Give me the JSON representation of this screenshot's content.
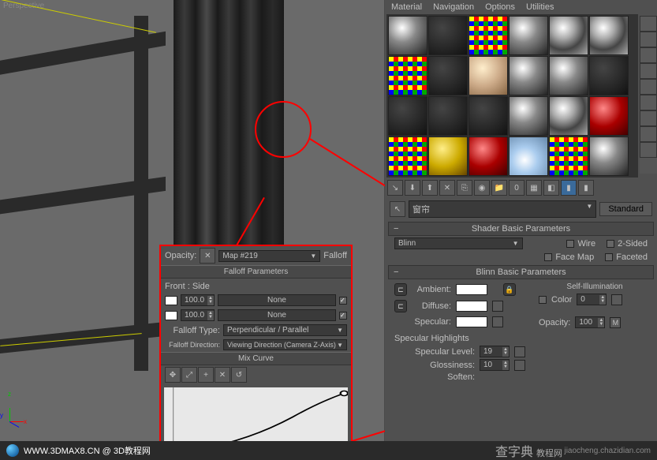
{
  "viewport": {
    "label": "Perspective"
  },
  "menu": {
    "material": "Material",
    "navigation": "Navigation",
    "options": "Options",
    "utilities": "Utilities"
  },
  "name_row": {
    "material_name": "窗帘",
    "type_button": "Standard"
  },
  "shader_rollout": {
    "title": "Shader Basic Parameters",
    "shader": "Blinn",
    "wire": "Wire",
    "two_sided": "2-Sided",
    "face_map": "Face Map",
    "faceted": "Faceted"
  },
  "blinn_rollout": {
    "title": "Blinn Basic Parameters",
    "self_illum_label": "Self-Illumination",
    "ambient": "Ambient:",
    "diffuse": "Diffuse:",
    "specular": "Specular:",
    "color_label": "Color",
    "color_value": "0",
    "opacity_label": "Opacity:",
    "opacity_value": "100",
    "opacity_map": "M",
    "spec_highlights": "Specular Highlights",
    "spec_level": "Specular Level:",
    "spec_level_val": "19",
    "glossiness": "Glossiness:",
    "glossiness_val": "10",
    "soften": "Soften:"
  },
  "map_panel": {
    "opacity_label": "Opacity:",
    "map_name": "Map #219",
    "map_type": "Falloff",
    "falloff_params": "Falloff Parameters",
    "front_side": "Front : Side",
    "val1": "100.0",
    "map1": "None",
    "val2": "100.0",
    "map2": "None",
    "falloff_type_label": "Falloff Type:",
    "falloff_type": "Perpendicular / Parallel",
    "falloff_dir_label": "Falloff Direction:",
    "falloff_dir": "Viewing Direction (Camera Z-Axis)",
    "mix_curve": "Mix Curve"
  },
  "footer": {
    "url": "WWW.3DMAX8.CN @ 3D教程网",
    "brand": "查字典",
    "brand_sub": "教程网",
    "small": "jiaocheng.chazidian.com"
  }
}
